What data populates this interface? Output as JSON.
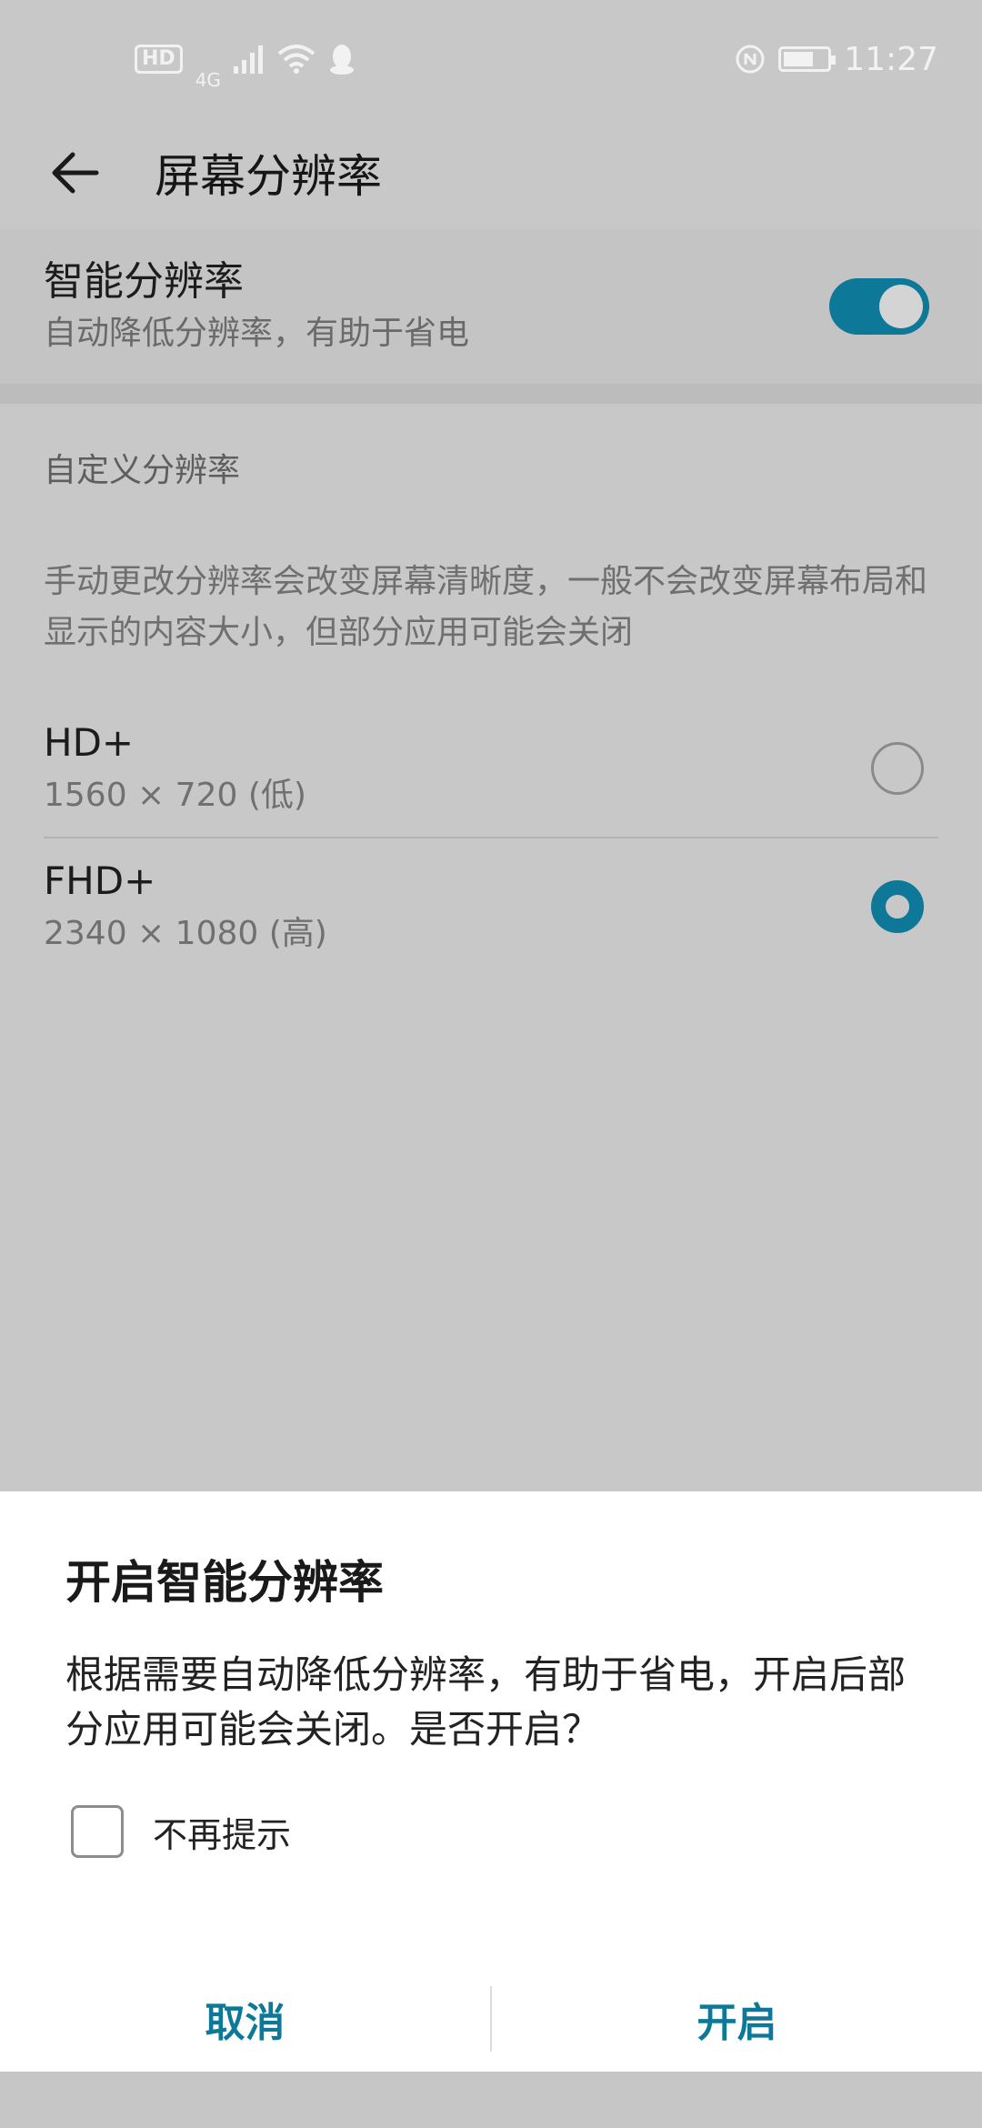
{
  "status_bar": {
    "hd_badge": "HD",
    "network": "4G",
    "time": "11:27",
    "icons": [
      "signal-icon",
      "wifi-icon",
      "qq-icon",
      "nfc-icon",
      "battery-icon"
    ]
  },
  "header": {
    "back_icon": "back-arrow-icon",
    "title": "屏幕分辨率"
  },
  "smart_resolution": {
    "title": "智能分辨率",
    "subtitle": "自动降低分辨率，有助于省电",
    "toggle_on": true
  },
  "custom": {
    "section_label": "自定义分辨率",
    "description": "手动更改分辨率会改变屏幕清晰度，一般不会改变屏幕布局和显示的内容大小，但部分应用可能会关闭",
    "options": [
      {
        "title": "HD+",
        "subtitle": "1560 × 720 (低)",
        "selected": false
      },
      {
        "title": "FHD+",
        "subtitle": "2340 × 1080 (高)",
        "selected": true
      }
    ]
  },
  "dialog": {
    "title": "开启智能分辨率",
    "message": "根据需要自动降低分辨率，有助于省电，开启后部分应用可能会关闭。是否开启？",
    "checkbox_label": "不再提示",
    "cancel_label": "取消",
    "confirm_label": "开启"
  },
  "colors": {
    "accent": "#0e7899",
    "scrim_bg": "#c8c8c8",
    "dialog_bg": "#ffffff"
  }
}
